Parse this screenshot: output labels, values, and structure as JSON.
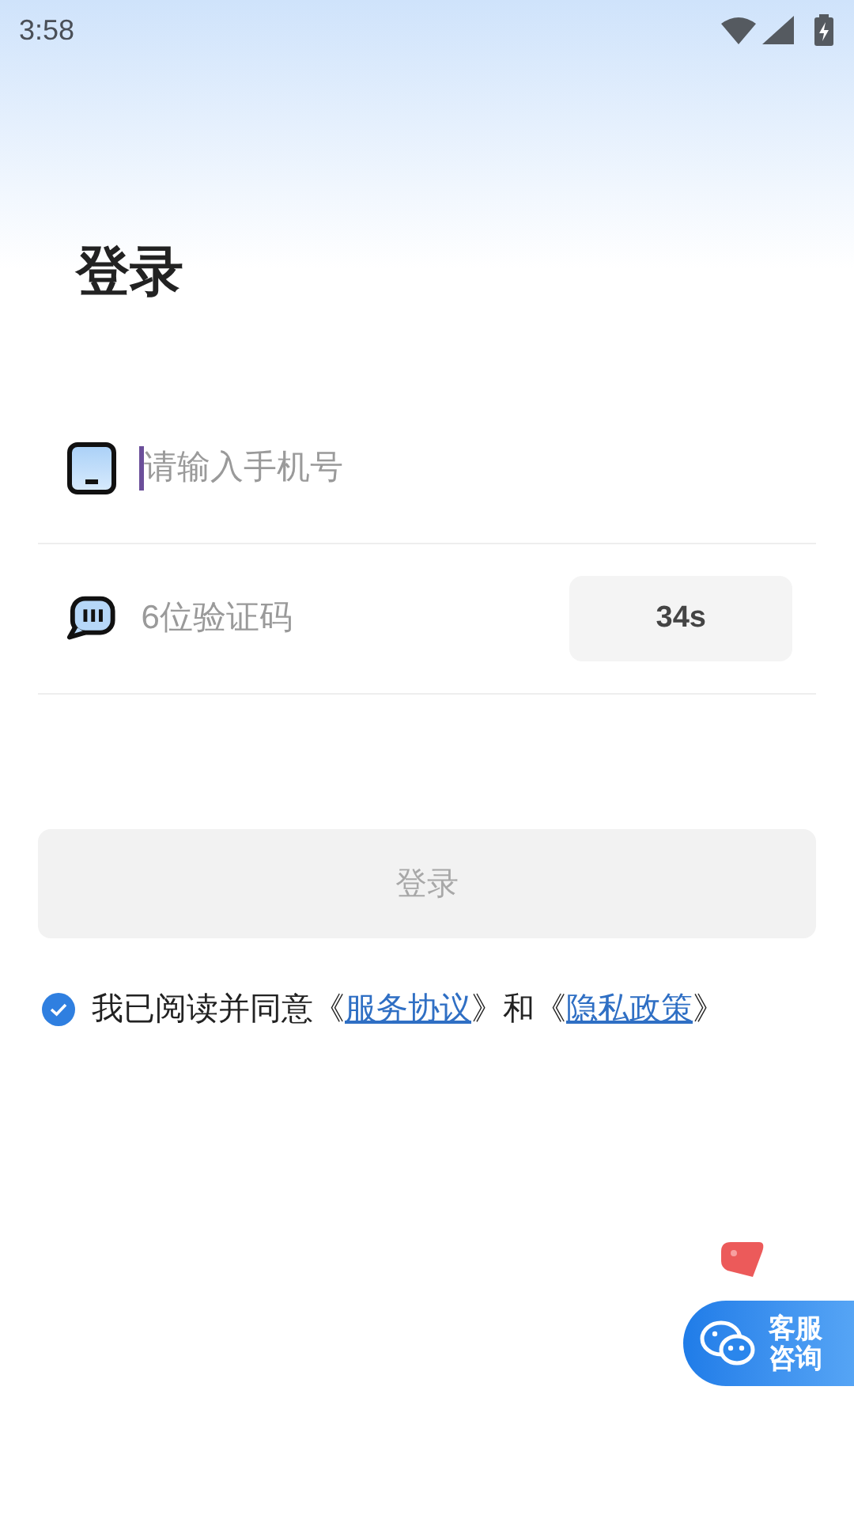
{
  "status_bar": {
    "time": "3:58"
  },
  "title": "登录",
  "phone_field": {
    "placeholder": "请输入手机号",
    "focused": true
  },
  "code_field": {
    "placeholder": "6位验证码",
    "countdown": "34s"
  },
  "login_button": {
    "label": "登录",
    "disabled": true
  },
  "agreement": {
    "checked": true,
    "parts": [
      {
        "kind": "text",
        "text": "我已阅读并同意《"
      },
      {
        "kind": "link",
        "text": "服务协议"
      },
      {
        "kind": "text",
        "text": "》和《"
      },
      {
        "kind": "link",
        "text": "隐私政策"
      },
      {
        "kind": "text",
        "text": "》"
      }
    ]
  },
  "support_button": {
    "label_line1": "客服",
    "label_line2": "咨询"
  }
}
